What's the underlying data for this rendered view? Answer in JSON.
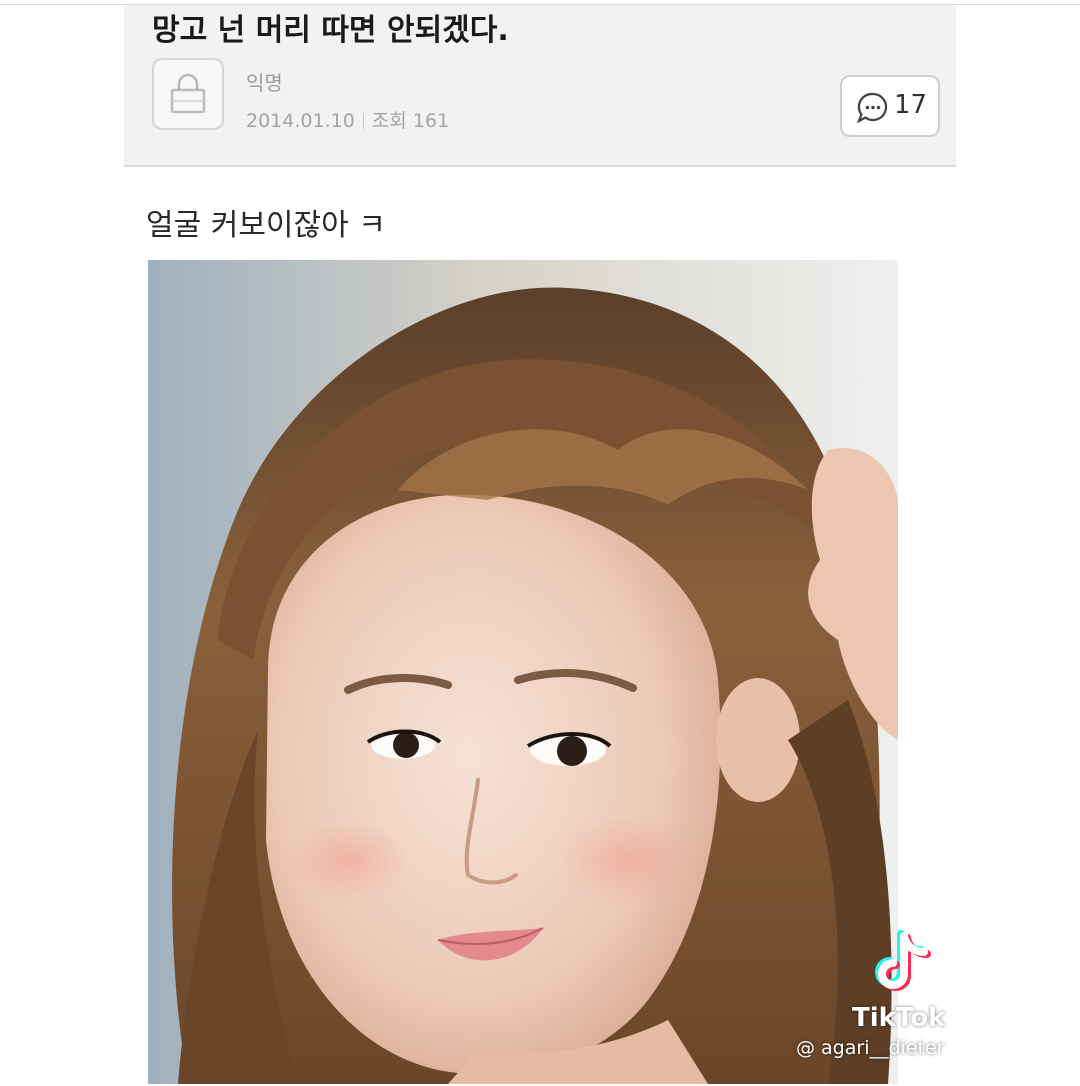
{
  "post": {
    "title": "망고 넌 머리 따면 안되겠다.",
    "author": "익명",
    "date": "2014.01.10",
    "views_label": "조회",
    "views": "161",
    "comment_count": "17"
  },
  "content": {
    "text": "얼굴 커보이잖아 ㅋ"
  },
  "watermark": {
    "brand": "TikTok",
    "handle": "@ agari__dieter"
  },
  "icons": {
    "avatar": "lock-icon",
    "comment": "speech-bubble-icon",
    "tiktok": "tiktok-note-icon"
  },
  "colors": {
    "header_bg": "#f2f2f2",
    "meta_text": "#a3a3a3",
    "tiktok_cyan": "#25f4ee",
    "tiktok_red": "#fe2c55"
  }
}
